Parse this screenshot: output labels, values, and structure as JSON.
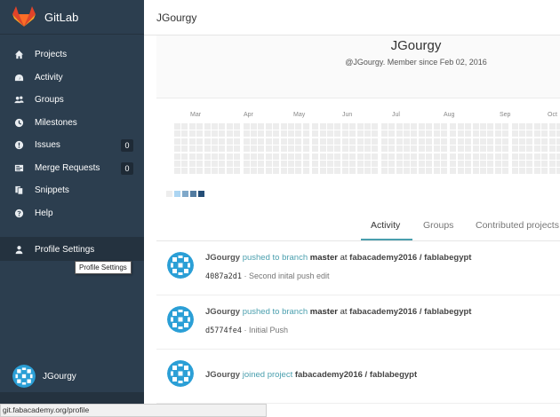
{
  "app": {
    "name": "GitLab"
  },
  "header": {
    "title": "JGourgy"
  },
  "sidebar": {
    "items": [
      {
        "label": "Projects",
        "icon": "home-icon"
      },
      {
        "label": "Activity",
        "icon": "dashboard-icon"
      },
      {
        "label": "Groups",
        "icon": "users-icon"
      },
      {
        "label": "Milestones",
        "icon": "clock-icon"
      },
      {
        "label": "Issues",
        "icon": "exclamation-circle-icon",
        "count": "0"
      },
      {
        "label": "Merge Requests",
        "icon": "list-icon",
        "count": "0"
      },
      {
        "label": "Snippets",
        "icon": "clipboard-icon"
      },
      {
        "label": "Help",
        "icon": "question-circle-icon"
      }
    ],
    "profile_settings": {
      "label": "Profile Settings",
      "icon": "user-icon"
    },
    "tooltip": "Profile Settings",
    "user": {
      "name": "JGourgy"
    }
  },
  "profile": {
    "name": "JGourgy",
    "since": "@JGourgy. Member since Feb 02, 2016"
  },
  "calendar": {
    "months": [
      "Mar",
      "Apr",
      "May",
      "Jun",
      "Jul",
      "Aug",
      "Sep",
      "Oct"
    ],
    "cell_color": "#ededed",
    "legend_colors": [
      "#ededed",
      "#acd5f2",
      "#7fa8c9",
      "#527ba0",
      "#254e77"
    ]
  },
  "tabs": [
    {
      "label": "Activity",
      "active": true
    },
    {
      "label": "Groups",
      "active": false
    },
    {
      "label": "Contributed projects",
      "active": false
    }
  ],
  "events": [
    {
      "author": "JGourgy",
      "action": "pushed to branch",
      "branch": "master",
      "at": "at",
      "project": "fabacademy2016 / fablabegypt",
      "sha": "4087a2d1",
      "message": " · Second inital push edit"
    },
    {
      "author": "JGourgy",
      "action": "pushed to branch",
      "branch": "master",
      "at": "at",
      "project": "fabacademy2016 / fablabegypt",
      "sha": "d5774fe4",
      "message": " · Initial Push"
    },
    {
      "author": "JGourgy",
      "action": "joined project",
      "project": "fabacademy2016 / fablabegypt"
    }
  ],
  "statusbar": {
    "url": "git.fabacademy.org/profile"
  },
  "colors": {
    "sidebar_bg": "#2c3e4f",
    "accent": "#4a9fae",
    "avatar": "#2b9fd6"
  }
}
